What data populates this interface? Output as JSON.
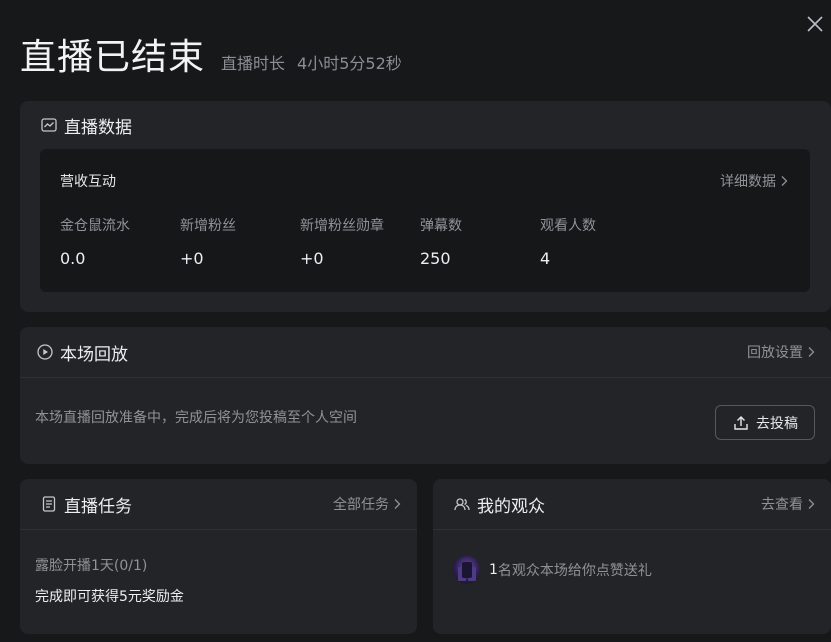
{
  "header": {
    "title": "直播已结束",
    "duration_label": "直播时长",
    "duration_value": "4小时5分52秒"
  },
  "live_data": {
    "title": "直播数据",
    "section_title": "营收互动",
    "detail_link": "详细数据",
    "stats": [
      {
        "label": "金仓鼠流水",
        "value": "0.0"
      },
      {
        "label": "新增粉丝",
        "value": "+0"
      },
      {
        "label": "新增粉丝勋章",
        "value": "+0"
      },
      {
        "label": "弹幕数",
        "value": "250"
      },
      {
        "label": "观看人数",
        "value": "4"
      }
    ]
  },
  "replay": {
    "title": "本场回放",
    "settings_link": "回放设置",
    "description": "本场直播回放准备中，完成后将为您投稿至个人空间",
    "upload_button": "去投稿"
  },
  "tasks": {
    "title": "直播任务",
    "all_link": "全部任务",
    "task_name": "露脸开播1天(0/1)",
    "task_reward": "完成即可获得5元奖励金"
  },
  "audience": {
    "title": "我的观众",
    "view_link": "去查看",
    "count": "1",
    "text": "名观众本场给你点赞送礼"
  },
  "icons": {
    "close": "close-icon",
    "chart": "line-chart-icon",
    "replay": "play-circle-icon",
    "document": "document-icon",
    "people": "people-icon",
    "upload": "upload-icon",
    "chevron": "chevron-right-icon"
  }
}
